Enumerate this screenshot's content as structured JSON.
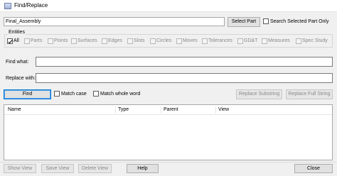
{
  "window": {
    "title": "Find/Replace"
  },
  "top": {
    "part_field_value": "Final_Assembly",
    "select_part_label": "Select Part",
    "search_selected_label": "Search Selected Part Only"
  },
  "entities": {
    "group_label": "Entities",
    "items": [
      {
        "label": "All",
        "checked": true,
        "enabled": true
      },
      {
        "label": "Parts",
        "checked": false,
        "enabled": false
      },
      {
        "label": "Points",
        "checked": false,
        "enabled": false
      },
      {
        "label": "Surfaces",
        "checked": false,
        "enabled": false
      },
      {
        "label": "Edges",
        "checked": false,
        "enabled": false
      },
      {
        "label": "Slots",
        "checked": false,
        "enabled": false
      },
      {
        "label": "Circles",
        "checked": false,
        "enabled": false
      },
      {
        "label": "Moves",
        "checked": false,
        "enabled": false
      },
      {
        "label": "Tolerances",
        "checked": false,
        "enabled": false
      },
      {
        "label": "GD&T",
        "checked": false,
        "enabled": false
      },
      {
        "label": "Measures",
        "checked": false,
        "enabled": false
      },
      {
        "label": "Spec Study",
        "checked": false,
        "enabled": false
      }
    ]
  },
  "find": {
    "label": "Find what:",
    "value": ""
  },
  "replace": {
    "label": "Replace with:",
    "value": ""
  },
  "actions": {
    "find_label": "Find",
    "match_case_label": "Match case",
    "match_whole_word_label": "Match whole word",
    "replace_substring_label": "Replace Substring",
    "replace_full_string_label": "Replace Full String"
  },
  "results": {
    "columns": [
      "Name",
      "Type",
      "Parent",
      "View"
    ]
  },
  "footer": {
    "show_view_label": "Show View",
    "save_view_label": "Save View",
    "delete_view_label": "Delete View",
    "help_label": "Help",
    "close_label": "Close"
  }
}
